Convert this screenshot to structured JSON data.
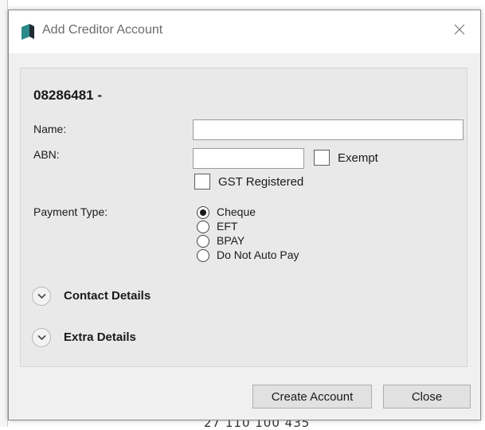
{
  "window": {
    "title": "Add Creditor Account"
  },
  "background": {
    "bottom_text": "27 110 100 435"
  },
  "form": {
    "account_heading": "08286481  -",
    "name_label": "Name:",
    "name_value": "",
    "abn_label": "ABN:",
    "abn_value": "",
    "exempt_label": "Exempt",
    "exempt_checked": false,
    "gst_label": "GST Registered",
    "gst_checked": false,
    "payment_type_label": "Payment Type:",
    "payment_options": [
      {
        "label": "Cheque",
        "selected": true
      },
      {
        "label": "EFT",
        "selected": false
      },
      {
        "label": "BPAY",
        "selected": false
      },
      {
        "label": "Do Not Auto Pay",
        "selected": false
      }
    ],
    "sections": [
      {
        "label": "Contact Details",
        "expanded": false
      },
      {
        "label": "Extra Details",
        "expanded": false
      }
    ]
  },
  "footer": {
    "create_label": "Create Account",
    "close_label": "Close"
  },
  "colors": {
    "dialog_bg": "#f0f0f0",
    "panel_bg": "#e9e9e9",
    "icon_teal": "#2a8a8a",
    "icon_dark": "#1f2b33"
  }
}
